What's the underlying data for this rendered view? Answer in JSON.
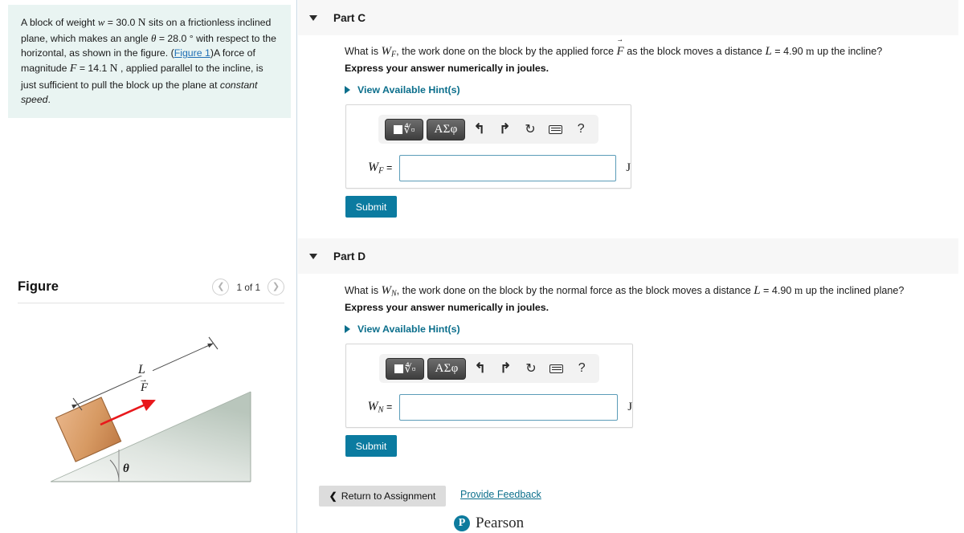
{
  "problem": {
    "text_1": "A block of weight ",
    "w_sym": "w",
    "w_val": " = 30.0 ",
    "w_unit": "N",
    "text_2": " sits on a frictionless inclined plane, which makes an angle ",
    "theta_sym": "θ",
    "theta_val": " = 28.0 ",
    "deg": "°",
    "text_3": " with respect to the horizontal, as shown in the figure. (",
    "figure_link": "Figure 1",
    "text_4": ")A force of magnitude ",
    "F_sym": "F",
    "F_val": " = 14.1 ",
    "F_unit": "N",
    "text_5": " , applied parallel to the incline, is just sufficient to pull the block up the plane at ",
    "emph": "constant speed",
    "text_6": "."
  },
  "figure": {
    "title": "Figure",
    "pager_label": "1 of 1",
    "prev_icon": "chevron-left-icon",
    "next_icon": "chevron-right-icon",
    "labels": {
      "L": "L",
      "F": "F",
      "theta": "θ"
    },
    "colors": {
      "block_light": "#e0a878",
      "block_dark": "#c07b46",
      "block_border": "#9a6336",
      "incline_top": "#c3cfc7",
      "incline_bottom": "#f2f4f2",
      "arrow_red": "#e8181c",
      "dim_line": "#4b4b4b"
    }
  },
  "parts": [
    {
      "id": "part-c",
      "title": "Part C",
      "q_pre": "What is ",
      "q_var": "W",
      "q_sub": "F",
      "q_mid1": ", the work done on the block by the applied force ",
      "q_force": "F",
      "q_mid2": " as the block moves a distance ",
      "q_L": "L",
      "q_Lval": " = 4.90 ",
      "q_Lunit": "m",
      "q_post": " up the incline?",
      "express": "Express your answer numerically in joules.",
      "hint_label": "View Available Hint(s)",
      "answer_label_var": "W",
      "answer_label_sub": "F",
      "answer_label_eq": " =",
      "answer_value": "",
      "answer_unit": "J",
      "submit_label": "Submit"
    },
    {
      "id": "part-d",
      "title": "Part D",
      "q_pre": "What is ",
      "q_var": "W",
      "q_sub": "N",
      "q_mid1": ", the work done on the block by the normal force as the block moves a distance ",
      "q_force": "",
      "q_mid2": "",
      "q_L": "L",
      "q_Lval": " = 4.90 ",
      "q_Lunit": "m",
      "q_post": " up the inclined plane?",
      "express": "Express your answer numerically in joules.",
      "hint_label": "View Available Hint(s)",
      "answer_label_var": "W",
      "answer_label_sub": "N",
      "answer_label_eq": " =",
      "answer_value": "",
      "answer_unit": "J",
      "submit_label": "Submit"
    }
  ],
  "mathbar": {
    "template_button": "template-root-icon",
    "greek_button": "ΑΣφ",
    "undo_icon": "↰",
    "redo_icon": "↱",
    "reset_icon": "↻",
    "keyboard_icon": "keyboard-icon",
    "help_icon": "?"
  },
  "footer": {
    "return_label": "Return to Assignment",
    "return_chevron": "❮",
    "feedback_label": "Provide Feedback",
    "brand_mark": "P",
    "brand_name": "Pearson"
  }
}
